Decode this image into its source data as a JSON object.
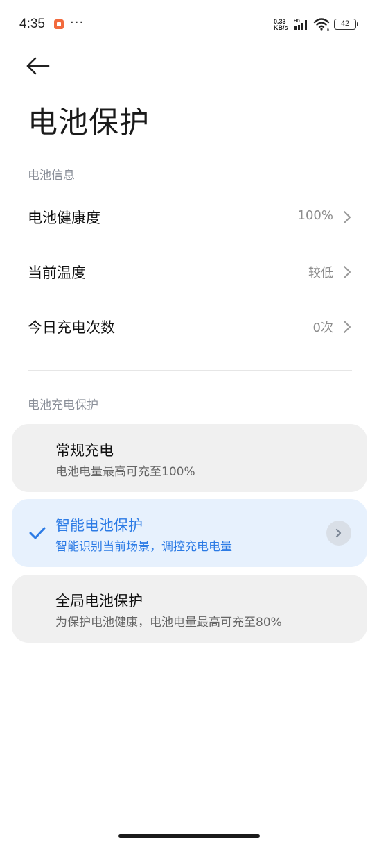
{
  "status_bar": {
    "time": "4:35",
    "more": "···",
    "net_speed_value": "0.33",
    "net_speed_unit": "KB/s",
    "signal_label": "HD",
    "battery": "42"
  },
  "header": {
    "title": "电池保护"
  },
  "battery_info": {
    "section_label": "电池信息",
    "rows": [
      {
        "label": "电池健康度",
        "value": "100%"
      },
      {
        "label": "当前温度",
        "value": "较低"
      },
      {
        "label": "今日充电次数",
        "value": "0次"
      }
    ]
  },
  "charge_protection": {
    "section_label": "电池充电保护",
    "options": [
      {
        "title": "常规充电",
        "desc": "电池电量最高可充至100%",
        "selected": false
      },
      {
        "title": "智能电池保护",
        "desc": "智能识别当前场景，调控充电电量",
        "selected": true
      },
      {
        "title": "全局电池保护",
        "desc": "为保护电池健康，电池电量最高可充至80%",
        "selected": false
      }
    ]
  },
  "colors": {
    "accent": "#2c7be5",
    "selected_card_bg": "#e7f1fd",
    "card_bg": "#f0f0f0",
    "secondary_text": "#8c8c8c",
    "notification": "#f26a3d"
  },
  "icons": {
    "back": "arrow-left-icon",
    "chevron": "chevron-right-icon",
    "check": "check-icon",
    "wifi": "wifi-icon",
    "signal": "signal-icon",
    "battery": "battery-icon",
    "notification": "notification-app-icon"
  }
}
